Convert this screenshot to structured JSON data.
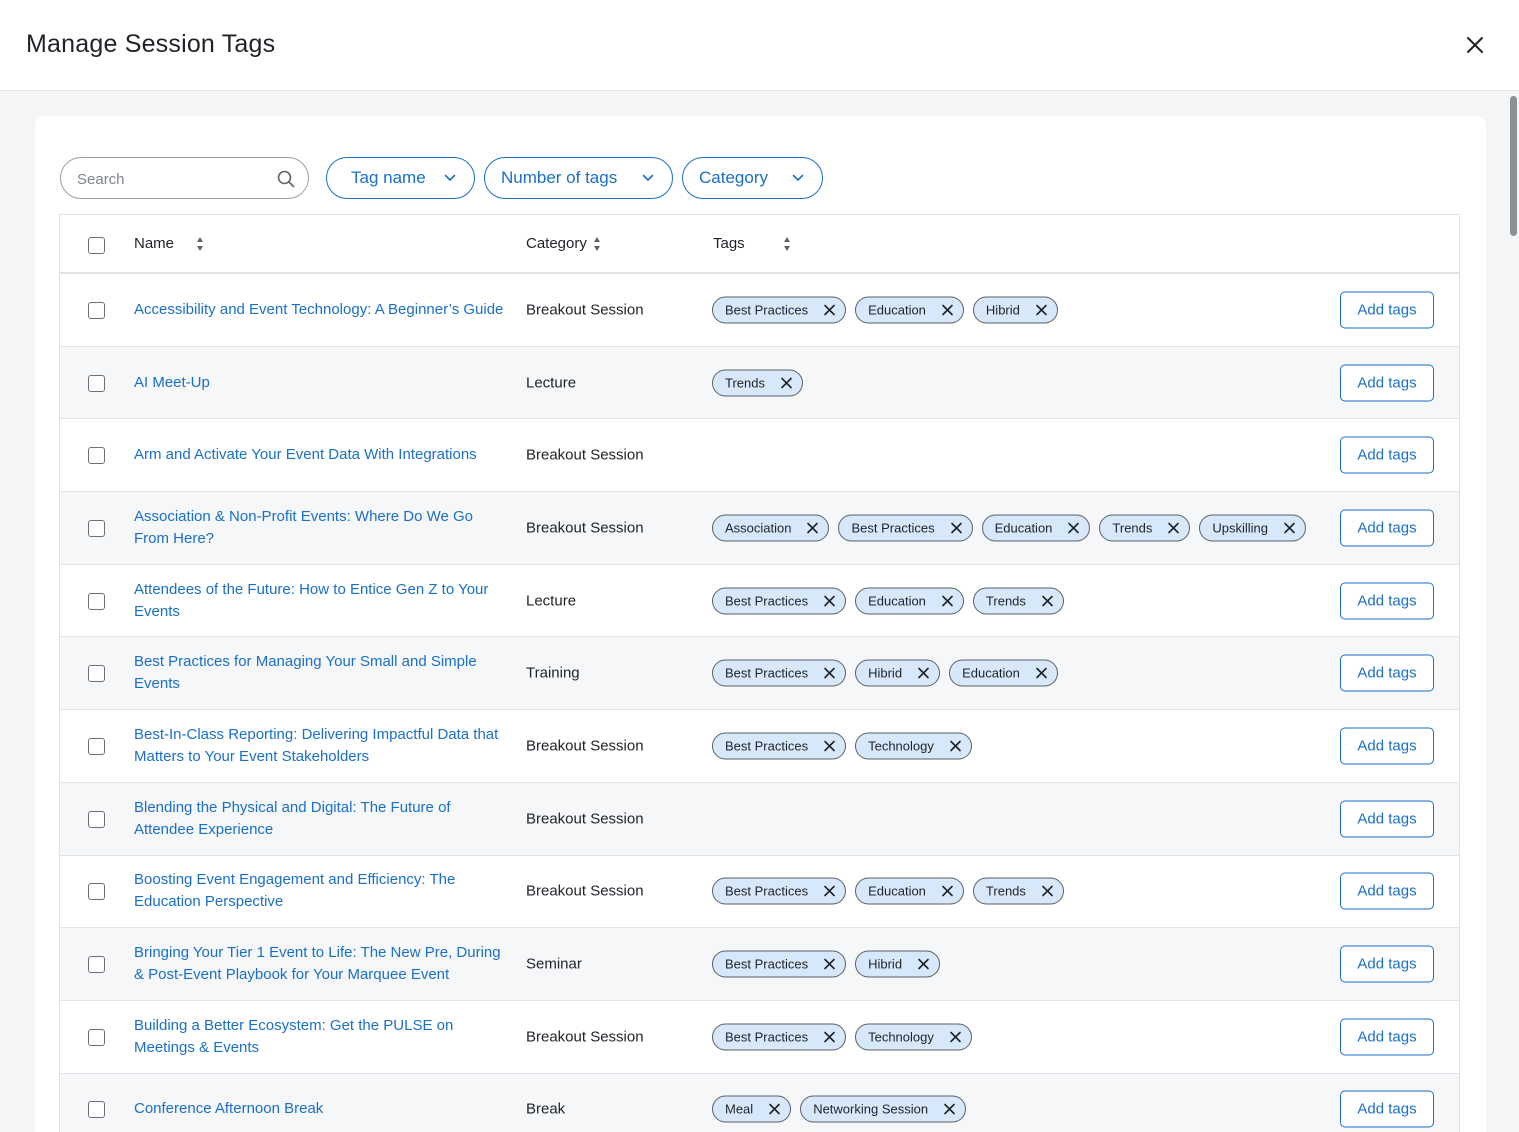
{
  "modal": {
    "title": "Manage Session Tags"
  },
  "filters": {
    "search_placeholder": "Search",
    "tag_name_label": "Tag name",
    "number_of_tags_label": "Number of tags",
    "category_label": "Category"
  },
  "table": {
    "headers": {
      "name": "Name",
      "category": "Category",
      "tags": "Tags"
    },
    "add_tags_label": "Add tags",
    "rows": [
      {
        "name": "Accessibility and Event Technology: A Beginner’s Guide",
        "category": "Breakout Session",
        "tags": [
          "Best Practices",
          "Education",
          "Hibrid"
        ]
      },
      {
        "name": "AI Meet-Up",
        "category": "Lecture",
        "tags": [
          "Trends"
        ]
      },
      {
        "name": "Arm and Activate Your Event Data With Integrations",
        "category": "Breakout Session",
        "tags": []
      },
      {
        "name": "Association & Non-Profit Events: Where Do We Go From Here?",
        "category": "Breakout Session",
        "tags": [
          "Association",
          "Best Practices",
          "Education",
          "Trends",
          "Upskilling"
        ]
      },
      {
        "name": "Attendees of the Future: How to Entice Gen Z to Your Events",
        "category": "Lecture",
        "tags": [
          "Best Practices",
          "Education",
          "Trends"
        ]
      },
      {
        "name": "Best Practices for Managing Your Small and Simple Events",
        "category": "Training",
        "tags": [
          "Best Practices",
          "Hibrid",
          "Education"
        ]
      },
      {
        "name": "Best-In-Class Reporting: Delivering Impactful Data that Matters to Your Event Stakeholders",
        "category": "Breakout Session",
        "tags": [
          "Best Practices",
          "Technology"
        ]
      },
      {
        "name": "Blending the Physical and Digital: The Future of Attendee Experience",
        "category": "Breakout Session",
        "tags": []
      },
      {
        "name": "Boosting Event Engagement and Efficiency: The Education Perspective",
        "category": "Breakout Session",
        "tags": [
          "Best Practices",
          "Education",
          "Trends"
        ]
      },
      {
        "name": "Bringing Your Tier 1 Event to Life: The New Pre, During & Post-Event Playbook for Your Marquee Event",
        "category": "Seminar",
        "tags": [
          "Best Practices",
          "Hibrid"
        ]
      },
      {
        "name": "Building a Better Ecosystem: Get the PULSE on Meetings & Events",
        "category": "Breakout Session",
        "tags": [
          "Best Practices",
          "Technology"
        ]
      },
      {
        "name": "Conference Afternoon Break",
        "category": "Break",
        "tags": [
          "Meal",
          "Networking Session"
        ]
      }
    ]
  }
}
